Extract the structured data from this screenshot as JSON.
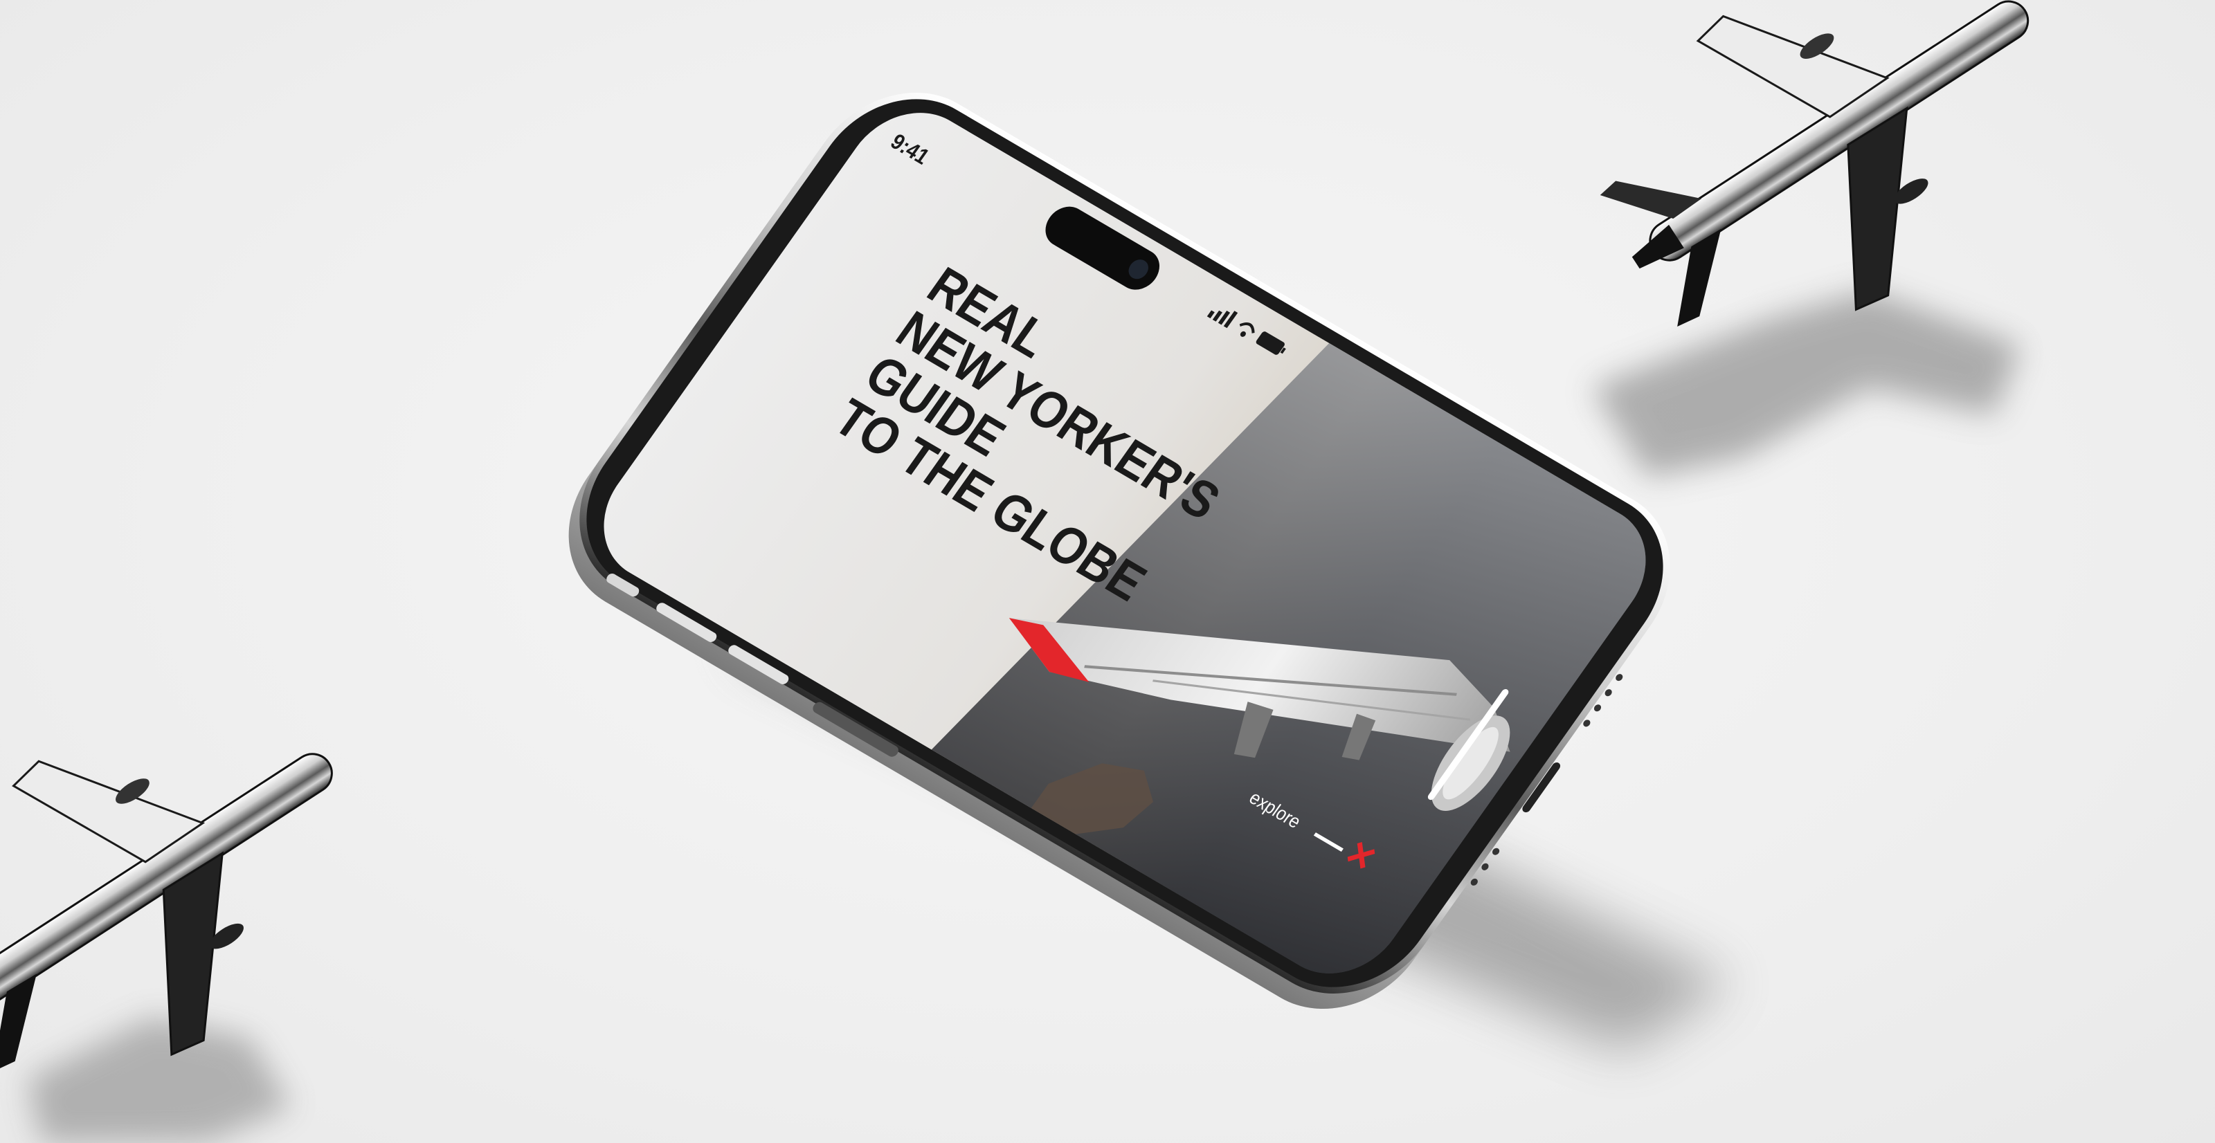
{
  "phone": {
    "status_time": "9:41",
    "headline_lines": [
      "REAL",
      "NEW YORKER'S",
      "GUIDE",
      "TO THE GLOBE"
    ],
    "explore_label": "explore",
    "close_glyph": "×",
    "icons": [
      "signal-icon",
      "wifi-icon",
      "battery-icon",
      "close-icon"
    ]
  },
  "colors": {
    "background": "#f1f1f1",
    "accent_red": "#e3262b",
    "headline": "#1a1a1a",
    "frame": "#2a2a2a"
  }
}
